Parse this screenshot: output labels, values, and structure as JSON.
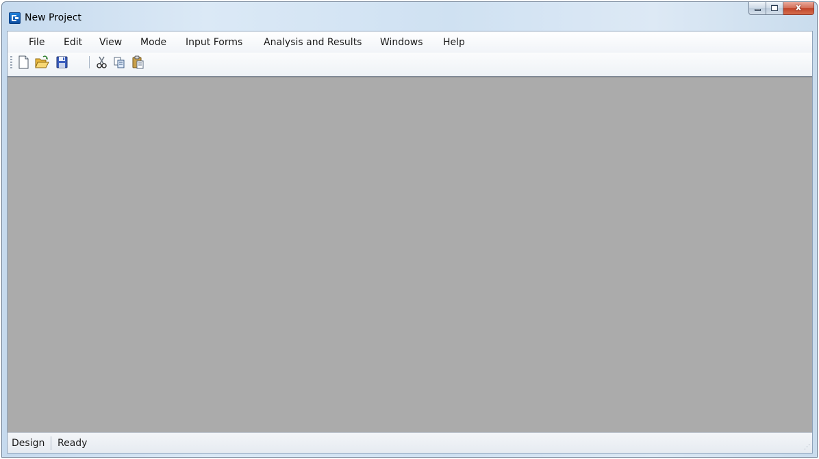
{
  "window": {
    "title": "New Project",
    "controls": {
      "minimize": "minimize",
      "maximize": "maximize",
      "close_glyph": "x"
    }
  },
  "menu": [
    "File",
    "Edit",
    "View",
    "Mode",
    "Input Forms",
    "Analysis and Results",
    "Windows",
    "Help"
  ],
  "toolbar": {
    "icons": [
      "new-file-icon",
      "open-folder-icon",
      "save-icon",
      "cut-icon",
      "copy-icon",
      "paste-icon"
    ]
  },
  "status": {
    "mode": "Design",
    "state": "Ready"
  },
  "colors": {
    "workspace": "#ababab",
    "title_gradient": "#cfe1f2"
  }
}
